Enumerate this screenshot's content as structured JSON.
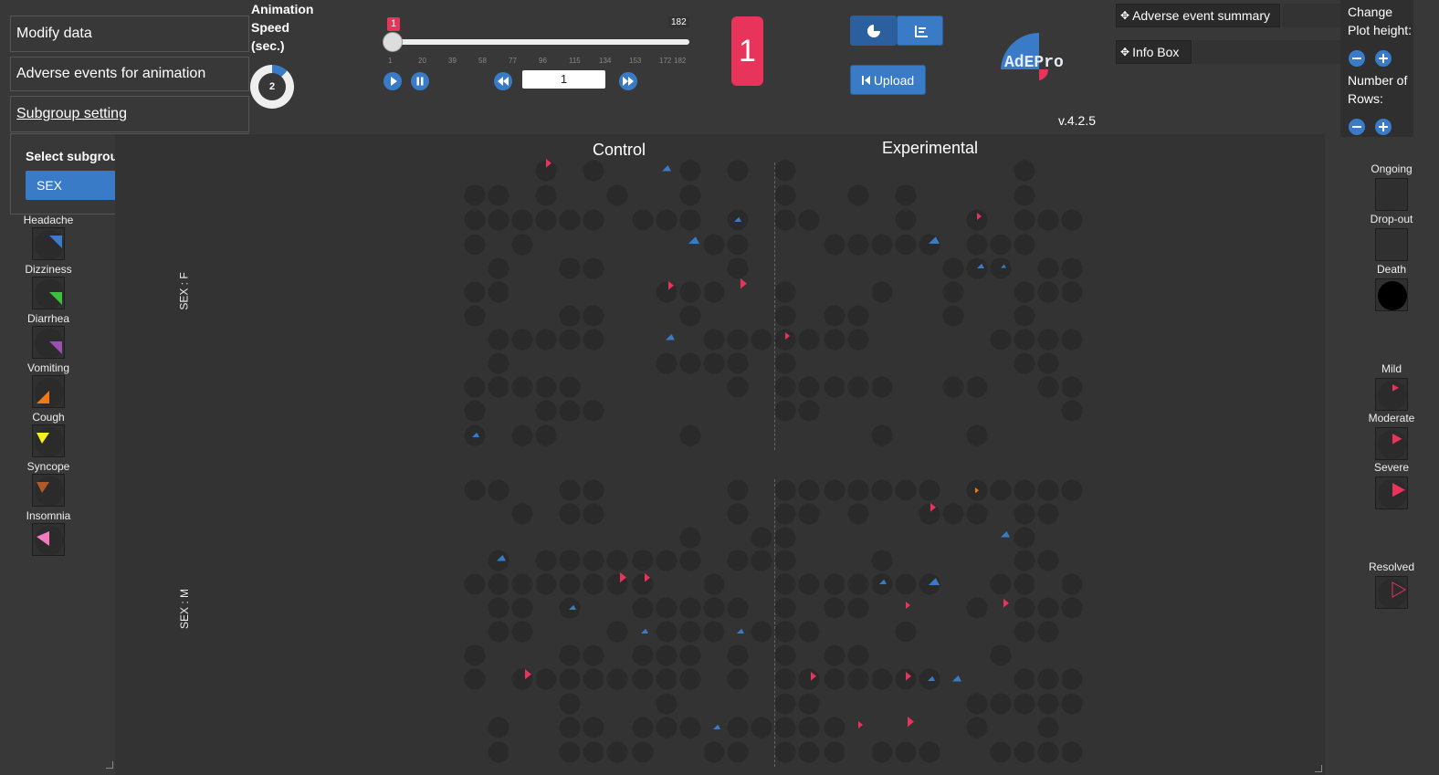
{
  "left_panel": {
    "modify_data": "Modify data",
    "ae_animation": "Adverse events for animation",
    "subgroup_setting": "Subgroup setting",
    "subgroup_label": "Select subgroup variable",
    "subgroup_value": "SEX"
  },
  "animation_speed": {
    "label_1": "Animation",
    "label_2": "Speed",
    "label_3": "(sec.)",
    "value": "2"
  },
  "slider": {
    "current_badge": "1",
    "max_label": "182",
    "ticks": [
      "1",
      "20",
      "39",
      "58",
      "77",
      "96",
      "115",
      "134",
      "153",
      "172",
      "182"
    ],
    "day_input": "1"
  },
  "day_counter": "1",
  "buttons": {
    "upload": "Upload"
  },
  "logo": {
    "text": "AdEPro"
  },
  "version": "v.4.2.5",
  "toolbar": {
    "ae_summary": "Adverse event summary",
    "info_box": "Info Box"
  },
  "plot_settings": {
    "change_1": "Change",
    "change_2": "Plot height:",
    "rows_1": "Number of",
    "rows_2": "Rows:"
  },
  "groups": {
    "control": "Control",
    "experimental": "Experimental"
  },
  "strips": {
    "female": "SEX : F",
    "male": "SEX : M"
  },
  "ae_legend": [
    {
      "label": "Headache",
      "color": "#3a7bc8",
      "icon": "triangle-top-right"
    },
    {
      "label": "Dizziness",
      "color": "#3fbf3f",
      "icon": "triangle-bottom-right"
    },
    {
      "label": "Diarrhea",
      "color": "#9b4fb0",
      "icon": "triangle-bottom-right"
    },
    {
      "label": "Vomiting",
      "color": "#f07a10",
      "icon": "triangle-bottom-left"
    },
    {
      "label": "Cough",
      "color": "#f5f020",
      "icon": "triangle-top-left"
    },
    {
      "label": "Syncope",
      "color": "#b05a2a",
      "icon": "triangle-top-left"
    },
    {
      "label": "Insomnia",
      "color": "#f07cc0",
      "icon": "triangle-left"
    }
  ],
  "status_legend": {
    "ongoing": "Ongoing",
    "dropout": "Drop-out",
    "death": "Death"
  },
  "severity_legend": {
    "mild": "Mild",
    "moderate": "Moderate",
    "severe": "Severe",
    "resolved": "Resolved"
  }
}
